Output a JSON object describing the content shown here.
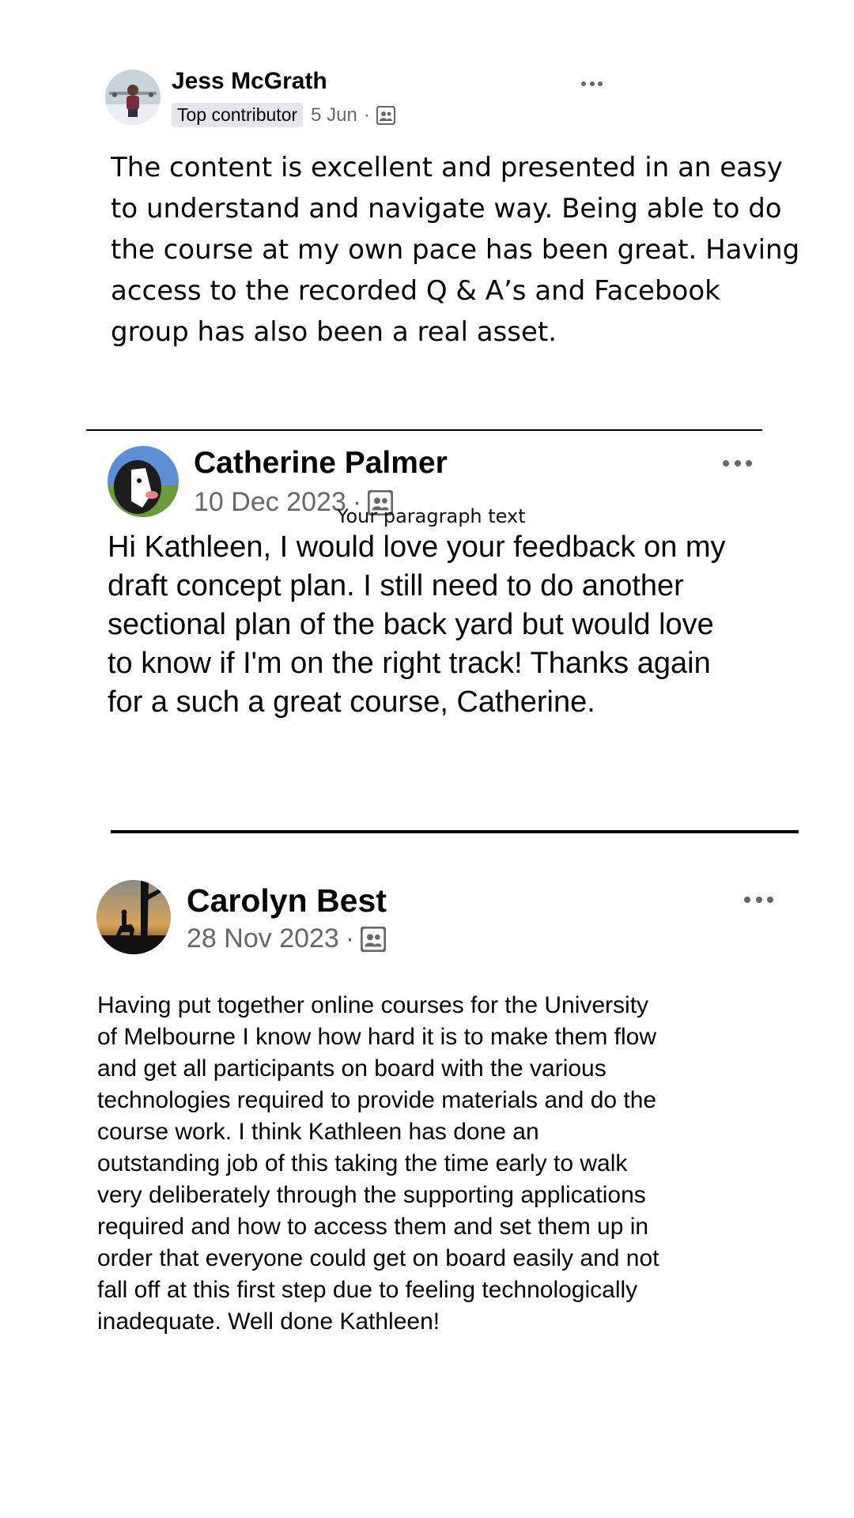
{
  "reviews": [
    {
      "author": "Jess McGrath",
      "badge": "Top contributor",
      "date": "5 Jun",
      "separator": "·",
      "privacy_icon": "members-icon",
      "more_icon": "more-options-icon",
      "text": "The content is excellent and presented in an easy to understand and navigate way. Being able to do the course at my own pace has been great. Having access to the recorded Q & A’s and Facebook group has also been a real asset."
    },
    {
      "author": "Catherine Palmer",
      "date": "10 Dec 2023",
      "separator": "·",
      "privacy_icon": "members-icon",
      "more_icon": "more-options-icon",
      "text": "Hi Kathleen, I would love your feedback on my draft concept plan. I still need to do another sectional plan of the back yard but would love to know if I'm on the right track! Thanks again for a such a great course, Catherine."
    },
    {
      "author": "Carolyn Best",
      "date": "28 Nov 2023",
      "separator": "·",
      "privacy_icon": "members-icon",
      "more_icon": "more-options-icon",
      "lines": [
        "Having put together online courses for the University",
        "of Melbourne I know how hard it is to make them flow",
        "and get all participants on board with the various",
        "technologies required to provide materials and do the",
        "course work. I think Kathleen has done an",
        "outstanding job of this taking the time early to walk",
        "very deliberately through the supporting applications",
        "required and how to access them and set them up in",
        "order that everyone could get on board easily and not",
        "fall off at this first step due to feeling technologically",
        "inadequate. Well done Kathleen!"
      ]
    }
  ],
  "overlay_text": "Your paragraph text",
  "colors": {
    "text": "#050505",
    "meta": "#65676b",
    "badge_bg": "#e4e6eb",
    "divider": "#000000"
  }
}
